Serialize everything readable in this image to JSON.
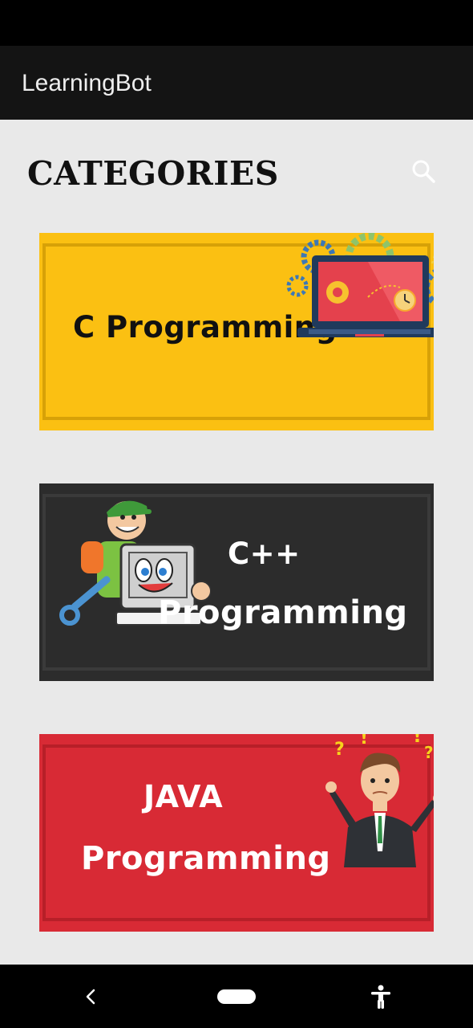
{
  "app": {
    "title": "LearningBot"
  },
  "page": {
    "heading": "CATEGORIES"
  },
  "icons": {
    "search": "search-icon",
    "back": "back-icon",
    "home": "home-pill",
    "accessibility": "accessibility-icon"
  },
  "categories": [
    {
      "id": "c",
      "line1": "C Programming",
      "color": "#fbc012"
    },
    {
      "id": "cpp",
      "line1": "C++",
      "line2": "Programming",
      "color": "#2c2c2c"
    },
    {
      "id": "java",
      "line1": "JAVA",
      "line2": "Programming",
      "color": "#d82a35"
    }
  ]
}
